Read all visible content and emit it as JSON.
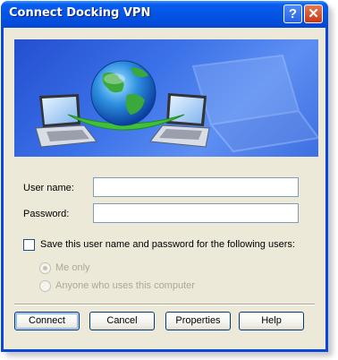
{
  "window": {
    "title": "Connect Docking VPN",
    "help_button": "?",
    "close_button": "✕"
  },
  "form": {
    "username_label": "User name:",
    "username_value": "",
    "password_label": "Password:",
    "password_value": "",
    "save_checkbox_label": "Save this user name and password for the following users:",
    "save_checked": false,
    "radio_options": [
      {
        "label": "Me only",
        "selected": true,
        "enabled": false
      },
      {
        "label": "Anyone who uses this computer",
        "selected": false,
        "enabled": false
      }
    ]
  },
  "buttons": {
    "connect": "Connect",
    "cancel": "Cancel",
    "properties": "Properties",
    "help": "Help"
  },
  "colors": {
    "titlebar": "#0455e6",
    "client": "#ece9d8",
    "banner": "#3b71e8"
  },
  "icons": {
    "banner": "network-globe-laptops"
  }
}
